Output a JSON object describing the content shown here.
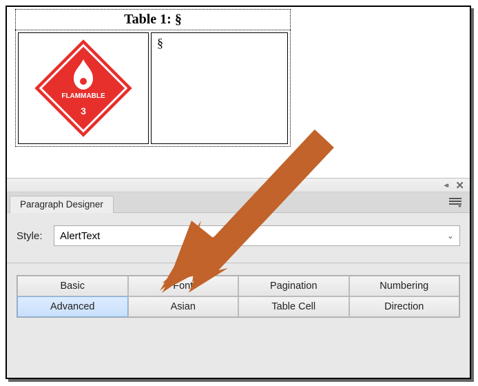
{
  "doc": {
    "caption_prefix": "Table 1: ",
    "caption_marker": "§",
    "cell_right_text": "§",
    "placard_label": "FLAMMABLE",
    "placard_class": "3"
  },
  "panel": {
    "title": "Paragraph Designer",
    "style_label": "Style:",
    "style_value": "AlertText",
    "tabs_row1": [
      "Basic",
      "Font",
      "Pagination",
      "Numbering"
    ],
    "tabs_row2": [
      "Advanced",
      "Asian",
      "Table Cell",
      "Direction"
    ],
    "selected_tab": "Advanced"
  },
  "colors": {
    "arrow": "#c1632a",
    "placard": "#e72f2c"
  }
}
